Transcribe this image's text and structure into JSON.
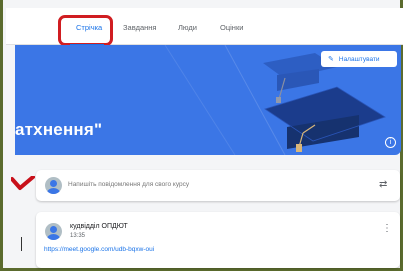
{
  "tabs": [
    {
      "label": "Стрічка",
      "active": true
    },
    {
      "label": "Завдання",
      "active": false
    },
    {
      "label": "Люди",
      "active": false
    },
    {
      "label": "Оцінки",
      "active": false
    }
  ],
  "banner": {
    "title": "атхнення\"",
    "customize_label": "Налаштувати",
    "color": "#3b76e6"
  },
  "composer": {
    "placeholder": "Напишіть повідомлення для свого курсу"
  },
  "post": {
    "author": "кудвідділ ОПДЮТ",
    "date": "13:35",
    "link": "https://meet.google.com/udb-bqxw-oui"
  },
  "colors": {
    "accent": "#1a73e8",
    "highlight": "#d01d21",
    "frame": "#5b6b2e"
  },
  "icons": [
    "pencil-icon",
    "info-icon",
    "repost-icon",
    "more-vert-icon",
    "checkmark-icon",
    "avatar-icon"
  ]
}
